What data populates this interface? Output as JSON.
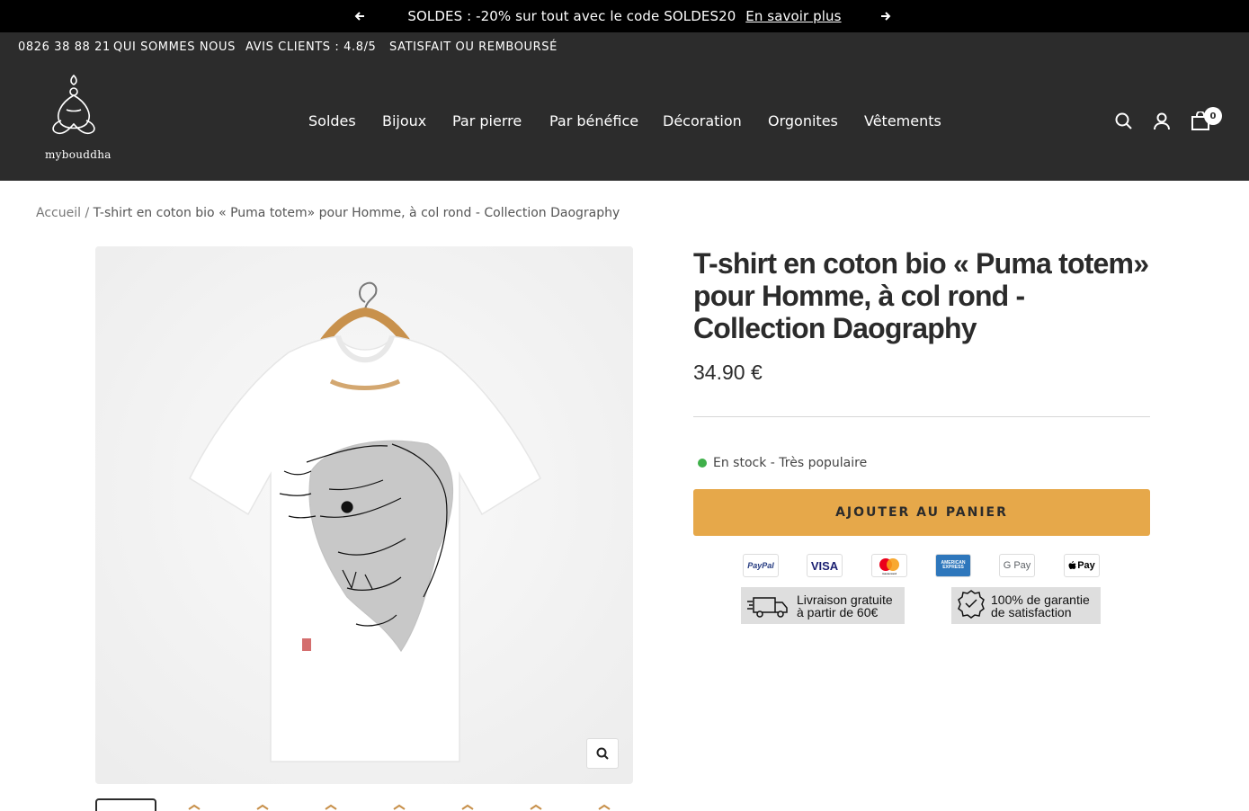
{
  "announcement": {
    "text": "SOLDES : -20% sur tout avec le code SOLDES20",
    "link": "En savoir plus"
  },
  "topnav": {
    "items": [
      "0826 38 88 21",
      "QUI SOMMES NOUS",
      "AVIS CLIENTS : 4.8/5",
      "SATISFAIT OU REMBOURSÉ"
    ]
  },
  "logo": {
    "text": "mybouddha"
  },
  "mainnav": {
    "items": [
      "Soldes",
      "Bijoux",
      "Par pierre",
      "Par bénéfice",
      "Décoration",
      "Orgonites",
      "Vêtements"
    ]
  },
  "cart": {
    "count": "0"
  },
  "breadcrumb": {
    "home": "Accueil",
    "separator": "/",
    "current": "T-shirt en coton bio « Puma totem» pour Homme, à col rond - Collection Daography"
  },
  "product": {
    "title": "T-shirt en coton bio « Puma totem» pour Homme, à col rond - Collection Daography",
    "price": "34.90 €",
    "stock": "En stock - Très populaire",
    "add_to_cart": "AJOUTER AU PANIER"
  },
  "payments": [
    "PayPal",
    "VISA",
    "mastercard",
    "AMERICAN EXPRESS",
    "G Pay",
    "Pay"
  ],
  "guarantees": {
    "shipping": [
      "Livraison gratuite",
      "à partir de 60€"
    ],
    "satisfaction": [
      "100% de garantie",
      "de satisfaction"
    ]
  },
  "colors": {
    "announce_bg": "#000000",
    "header_bg": "#2c2c2c",
    "accent": "#e6a84a",
    "stock_dot": "#3fb04a"
  }
}
